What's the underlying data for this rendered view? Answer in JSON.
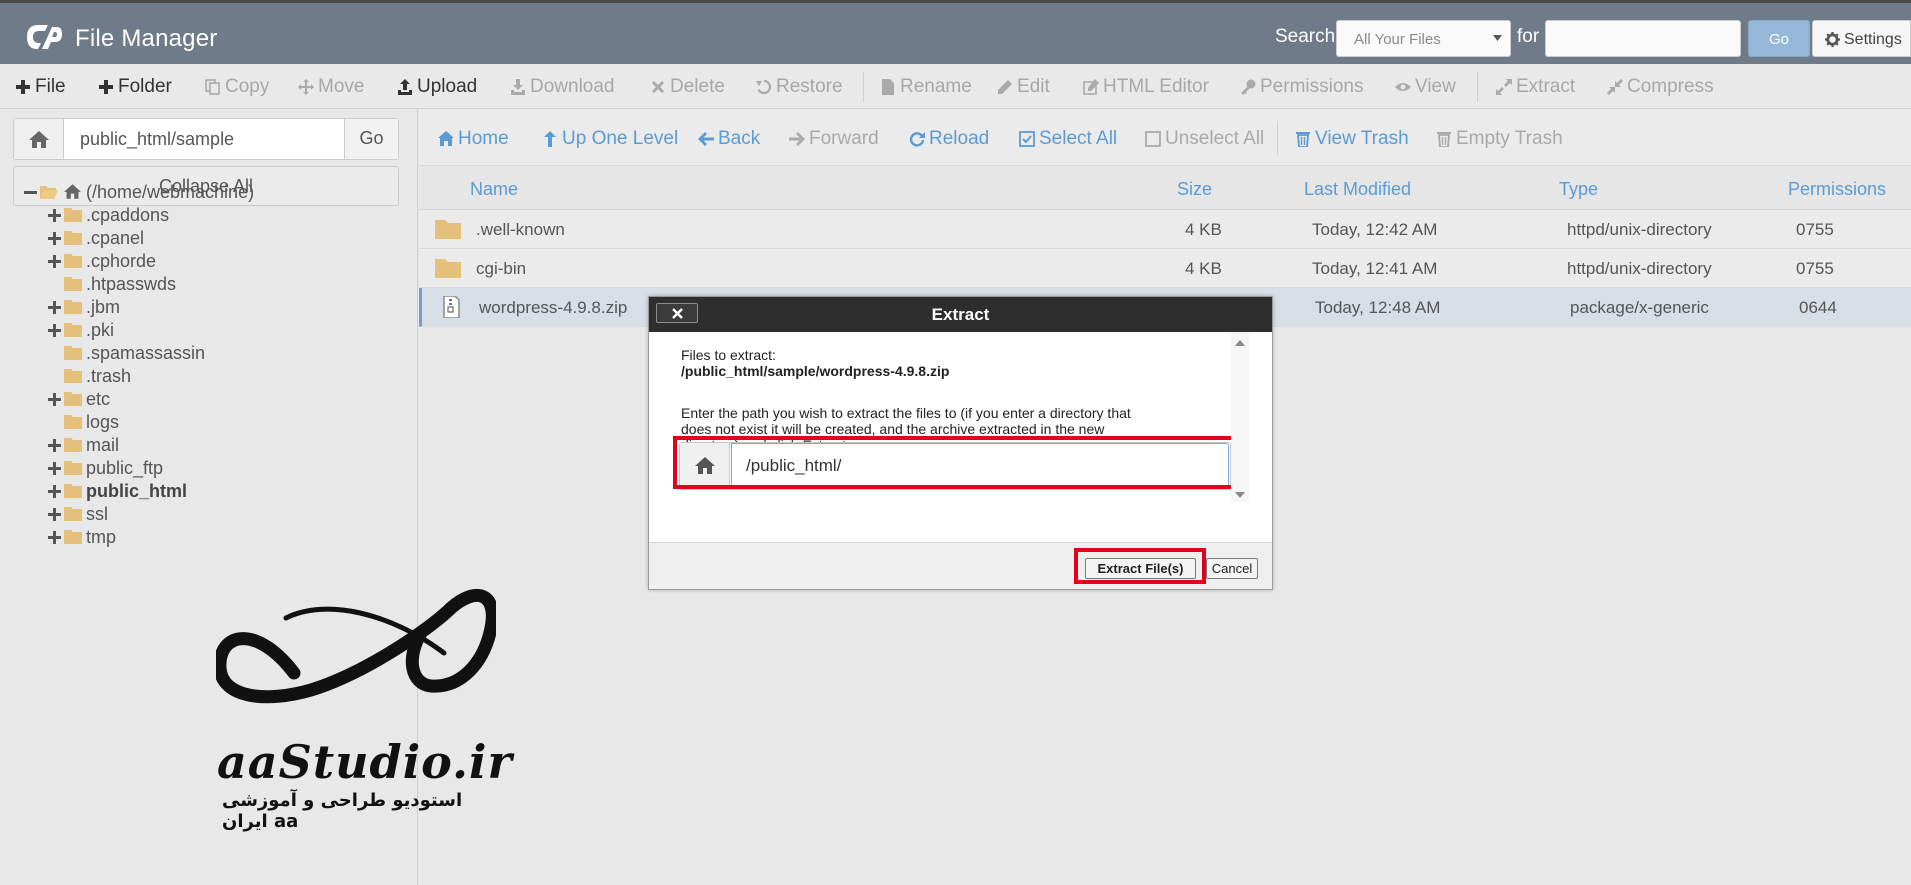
{
  "header": {
    "app_title": "File Manager",
    "search_label": "Search",
    "search_scope": "All Your Files",
    "for_label": "for",
    "search_value": "",
    "go_label": "Go",
    "settings_label": "Settings"
  },
  "toolbar": {
    "file": "File",
    "folder": "Folder",
    "copy": "Copy",
    "move": "Move",
    "upload": "Upload",
    "download": "Download",
    "delete": "Delete",
    "restore": "Restore",
    "rename": "Rename",
    "edit": "Edit",
    "html_editor": "HTML Editor",
    "permissions": "Permissions",
    "view": "View",
    "extract": "Extract",
    "compress": "Compress"
  },
  "sidebar": {
    "path_value": "public_html/sample",
    "go_label": "Go",
    "collapse_label": "Collapse All",
    "tree": [
      {
        "label": "(/home/webmachine)"
      },
      {
        "label": ".cpaddons"
      },
      {
        "label": ".cpanel"
      },
      {
        "label": ".cphorde"
      },
      {
        "label": ".htpasswds"
      },
      {
        "label": ".jbm"
      },
      {
        "label": ".pki"
      },
      {
        "label": ".spamassassin"
      },
      {
        "label": ".trash"
      },
      {
        "label": "etc"
      },
      {
        "label": "logs"
      },
      {
        "label": "mail"
      },
      {
        "label": "public_ftp"
      },
      {
        "label": "public_html"
      },
      {
        "label": "ssl"
      },
      {
        "label": "tmp"
      }
    ]
  },
  "nav": {
    "home": "Home",
    "up_one_level": "Up One Level",
    "back": "Back",
    "forward": "Forward",
    "reload": "Reload",
    "select_all": "Select All",
    "unselect_all": "Unselect All",
    "view_trash": "View Trash",
    "empty_trash": "Empty Trash"
  },
  "columns": {
    "name": "Name",
    "size": "Size",
    "last_modified": "Last Modified",
    "type": "Type",
    "permissions": "Permissions"
  },
  "files": [
    {
      "name": ".well-known",
      "size": "4 KB",
      "modified": "Today, 12:42 AM",
      "type": "httpd/unix-directory",
      "perms": "0755"
    },
    {
      "name": "cgi-bin",
      "size": "4 KB",
      "modified": "Today, 12:41 AM",
      "type": "httpd/unix-directory",
      "perms": "0755"
    },
    {
      "name": "wordpress-4.9.8.zip",
      "size": "",
      "modified": "Today, 12:48 AM",
      "type": "package/x-generic",
      "perms": "0644"
    }
  ],
  "dialog": {
    "title": "Extract",
    "files_label": "Files to extract:",
    "file_path": "/public_html/sample/wordpress-4.9.8.zip",
    "instructions_line1": "Enter the path you wish to extract the files to (if you enter a directory that",
    "instructions_line2": "does not exist it will be created, and the archive extracted in the new",
    "instructions_line3_prefix": "directory) and click ",
    "instructions_line3_emph": "Extract",
    "instructions_line3_suffix": ":",
    "path_value": "/public_html/",
    "extract_button": "Extract File(s)",
    "cancel_button": "Cancel"
  },
  "watermark": {
    "brand": "aaStudio.ir",
    "subtitle": "استودیو طراحی و آموزشی aa ایران"
  },
  "colors": {
    "header_bg": "#6f7b88",
    "link_blue": "#5b9bd5",
    "highlight_red": "#e2001a",
    "folder": "#e5c07b"
  }
}
